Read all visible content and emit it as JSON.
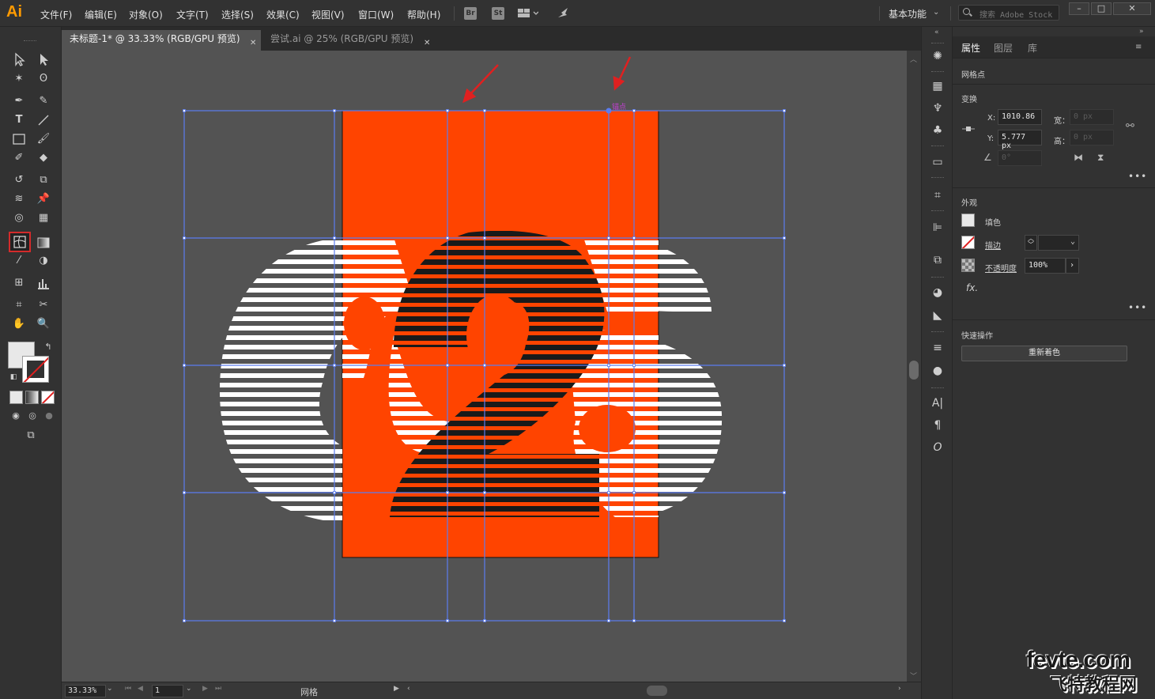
{
  "app": {
    "logo_text": "Ai",
    "menus": [
      "文件(F)",
      "编辑(E)",
      "对象(O)",
      "文字(T)",
      "选择(S)",
      "效果(C)",
      "视图(V)",
      "窗口(W)",
      "帮助(H)"
    ],
    "bridge_label": "Br",
    "stock_label": "St",
    "workspace": "基本功能",
    "search_placeholder": "搜索 Adobe Stock"
  },
  "tabs": [
    {
      "label": "未标题-1* @ 33.33% (RGB/GPU 预览)",
      "active": true
    },
    {
      "label": "尝试.ai @ 25% (RGB/GPU 预览)",
      "active": false
    }
  ],
  "canvas": {
    "artboard_color": "#ff4400",
    "mesh_color": "#5b7cf0",
    "anchor_label": "锚点",
    "arrow_color": "#e02020",
    "artwork": "Large number \"62\" made of horizontal stripes"
  },
  "status": {
    "zoom": "33.33%",
    "page": "1",
    "tool_name": "网格"
  },
  "properties": {
    "tabs": [
      "属性",
      "图层",
      "库"
    ],
    "selection_type": "网格点",
    "transform_title": "变换",
    "x_label": "X:",
    "x_value": "1010.86",
    "y_label": "Y:",
    "y_value": "5.777 px",
    "w_label": "宽：",
    "w_value": "0 px",
    "h_label": "高：",
    "h_value": "0 px",
    "angle_value": "0°",
    "appearance_title": "外观",
    "fill_label": "填色",
    "stroke_label": "描边",
    "opacity_label": "不透明度",
    "opacity_value": "100%",
    "fx_label": "fx.",
    "quick_actions_title": "快速操作",
    "recolor_button": "重新着色"
  },
  "watermark": {
    "latin": "fevte.com",
    "cn": "飞特教程网"
  }
}
